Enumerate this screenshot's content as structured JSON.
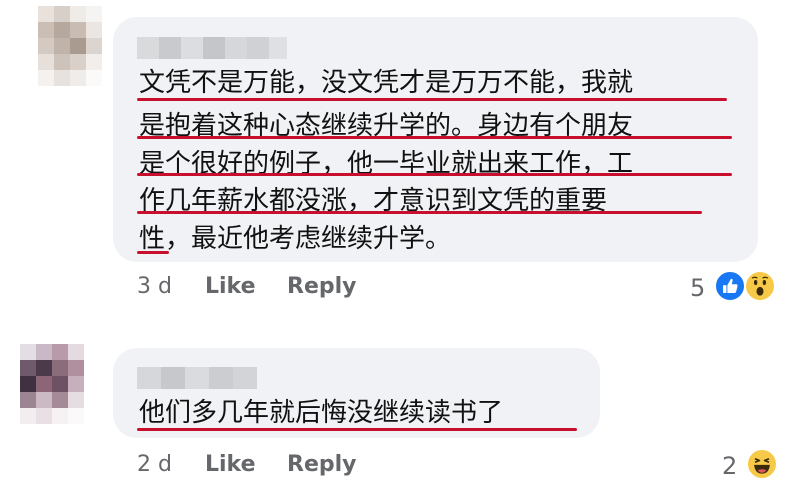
{
  "comments": [
    {
      "lines": [
        "文凭不是万能，没文凭才是万万不能，我就",
        "是抱着这种心态继续升学的。身边有个朋友",
        "是个很好的例子，他一毕业就出来工作，工",
        "作几年薪水都没涨，才意识到文凭的重要",
        "性，最近他考虑继续升学。"
      ],
      "time": "3 d",
      "like_label": "Like",
      "reply_label": "Reply",
      "reaction_count": "5",
      "reactions": [
        "like-icon",
        "wow-icon"
      ]
    },
    {
      "lines": [
        "他们多几年就后悔没继续读书了"
      ],
      "time": "2 d",
      "like_label": "Like",
      "reply_label": "Reply",
      "reaction_count": "2",
      "reactions": [
        "haha-icon"
      ]
    }
  ],
  "colors": {
    "bubble": "#f0f2f5",
    "underline": "#c8102e",
    "like_blue": "#1877f2",
    "emoji_yellow": "#f7c948",
    "meta_text": "#65676b"
  }
}
